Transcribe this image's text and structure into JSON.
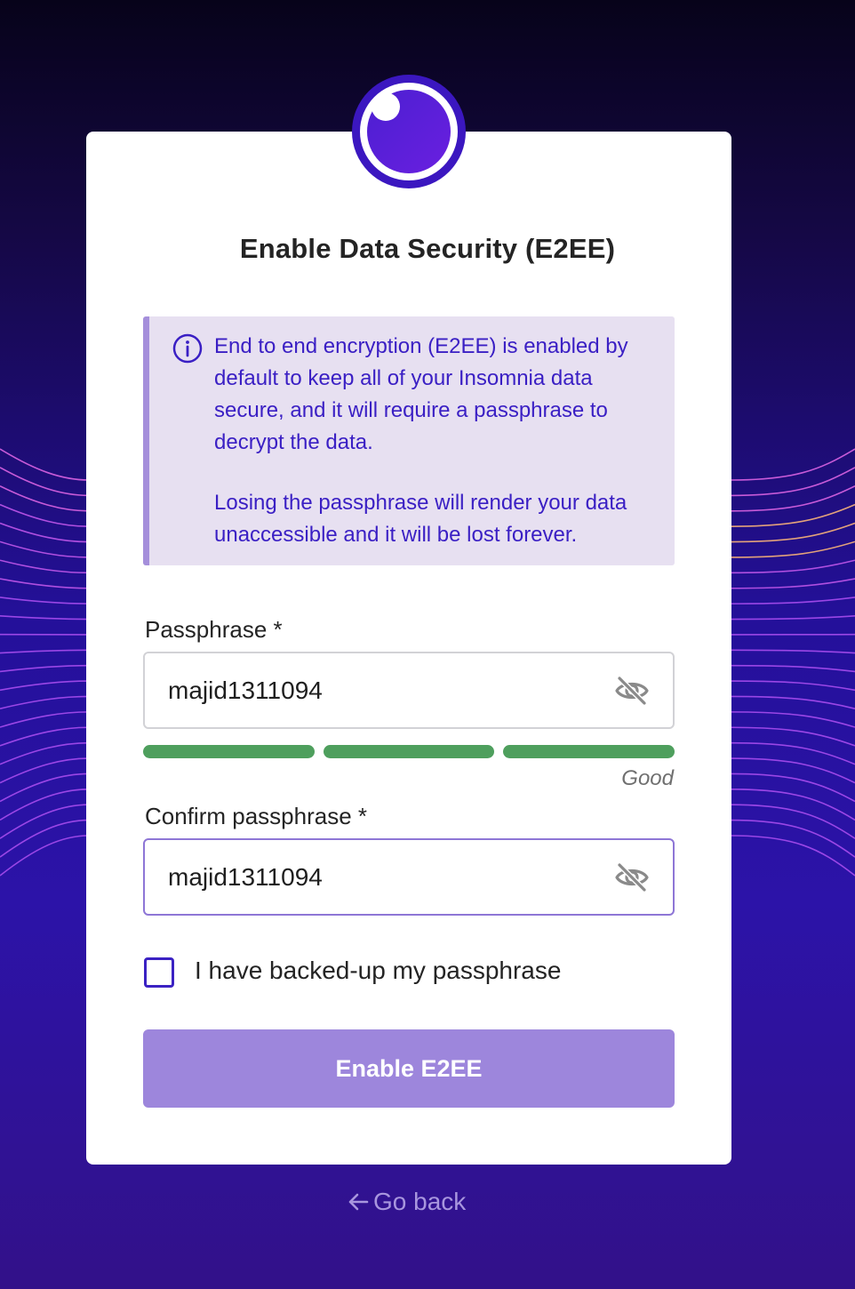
{
  "title": "Enable Data Security (E2EE)",
  "info": {
    "paragraph1": "End to end encryption (E2EE) is enabled by default to keep all of your Insomnia data secure, and it will require a passphrase to decrypt the data.",
    "paragraph2": "Losing the passphrase will render your data unaccessible and it will be lost forever."
  },
  "passphrase": {
    "label": "Passphrase *",
    "value": "majid1311094",
    "strength_label": "Good",
    "strength_segments_filled": 3,
    "strength_segments_total": 3
  },
  "confirm": {
    "label": "Confirm passphrase *",
    "value": "majid1311094"
  },
  "backup_checkbox": {
    "label": "I have backed-up my passphrase",
    "checked": false
  },
  "submit_label": "Enable E2EE",
  "back_label": "Go back",
  "icons": {
    "logo": "insomnia-logo",
    "info": "info-circle-icon",
    "visibility": "eye-slash-icon",
    "back": "arrow-left-icon"
  },
  "colors": {
    "accent": "#3b22c3",
    "info_bg": "#e7e0f1",
    "info_text": "#3a1fc4",
    "strength_good": "#4e9f5d",
    "button_bg": "#9d86dc"
  }
}
